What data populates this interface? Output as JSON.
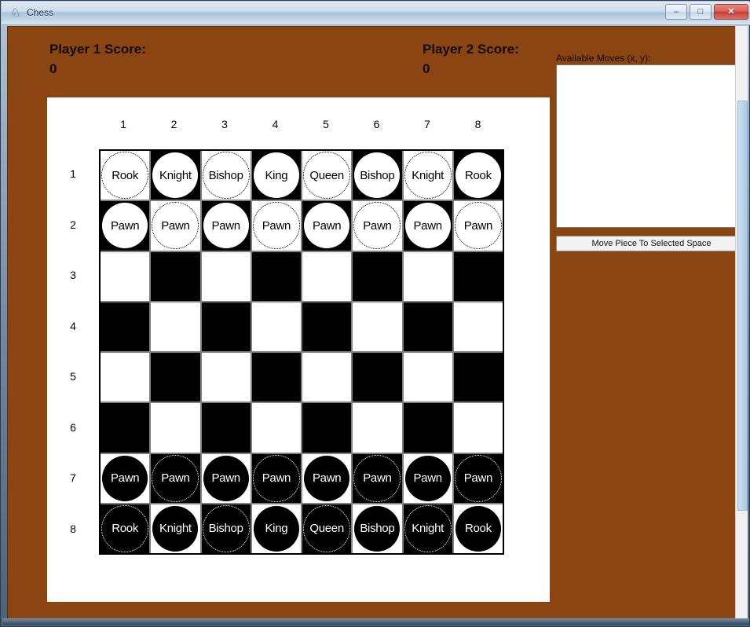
{
  "window": {
    "title": "Chess",
    "icon": "chess-rook-icon",
    "controls": {
      "minimize": "–",
      "maximize": "□",
      "close": "✕"
    },
    "background_color": "#8B4513"
  },
  "scores": {
    "player1": {
      "label": "Player 1 Score:",
      "value": "0",
      "text": "Player 1 Score:\n0"
    },
    "player2": {
      "label": "Player 2 Score:",
      "value": "0",
      "text": "Player 2 Score:\n0"
    }
  },
  "side_panel": {
    "moves_label": "Available Moves (x, y):",
    "moves_items": [],
    "move_button_label": "Move Piece To Selected Space"
  },
  "board": {
    "column_labels": [
      "1",
      "2",
      "3",
      "4",
      "5",
      "6",
      "7",
      "8"
    ],
    "row_labels": [
      "1",
      "2",
      "3",
      "4",
      "5",
      "6",
      "7",
      "8"
    ],
    "rows": [
      [
        {
          "piece": "Rook",
          "color": "white"
        },
        {
          "piece": "Knight",
          "color": "white"
        },
        {
          "piece": "Bishop",
          "color": "white"
        },
        {
          "piece": "King",
          "color": "white"
        },
        {
          "piece": "Queen",
          "color": "white"
        },
        {
          "piece": "Bishop",
          "color": "white"
        },
        {
          "piece": "Knight",
          "color": "white"
        },
        {
          "piece": "Rook",
          "color": "white"
        }
      ],
      [
        {
          "piece": "Pawn",
          "color": "white"
        },
        {
          "piece": "Pawn",
          "color": "white"
        },
        {
          "piece": "Pawn",
          "color": "white"
        },
        {
          "piece": "Pawn",
          "color": "white"
        },
        {
          "piece": "Pawn",
          "color": "white"
        },
        {
          "piece": "Pawn",
          "color": "white"
        },
        {
          "piece": "Pawn",
          "color": "white"
        },
        {
          "piece": "Pawn",
          "color": "white"
        }
      ],
      [
        null,
        null,
        null,
        null,
        null,
        null,
        null,
        null
      ],
      [
        null,
        null,
        null,
        null,
        null,
        null,
        null,
        null
      ],
      [
        null,
        null,
        null,
        null,
        null,
        null,
        null,
        null
      ],
      [
        null,
        null,
        null,
        null,
        null,
        null,
        null,
        null
      ],
      [
        {
          "piece": "Pawn",
          "color": "black"
        },
        {
          "piece": "Pawn",
          "color": "black"
        },
        {
          "piece": "Pawn",
          "color": "black"
        },
        {
          "piece": "Pawn",
          "color": "black"
        },
        {
          "piece": "Pawn",
          "color": "black"
        },
        {
          "piece": "Pawn",
          "color": "black"
        },
        {
          "piece": "Pawn",
          "color": "black"
        },
        {
          "piece": "Pawn",
          "color": "black"
        }
      ],
      [
        {
          "piece": "Rook",
          "color": "black"
        },
        {
          "piece": "Knight",
          "color": "black"
        },
        {
          "piece": "Bishop",
          "color": "black"
        },
        {
          "piece": "King",
          "color": "black"
        },
        {
          "piece": "Queen",
          "color": "black"
        },
        {
          "piece": "Bishop",
          "color": "black"
        },
        {
          "piece": "Knight",
          "color": "black"
        },
        {
          "piece": "Rook",
          "color": "black"
        }
      ]
    ],
    "square_colors": {
      "light": "#ffffff",
      "dark": "#000000"
    }
  }
}
